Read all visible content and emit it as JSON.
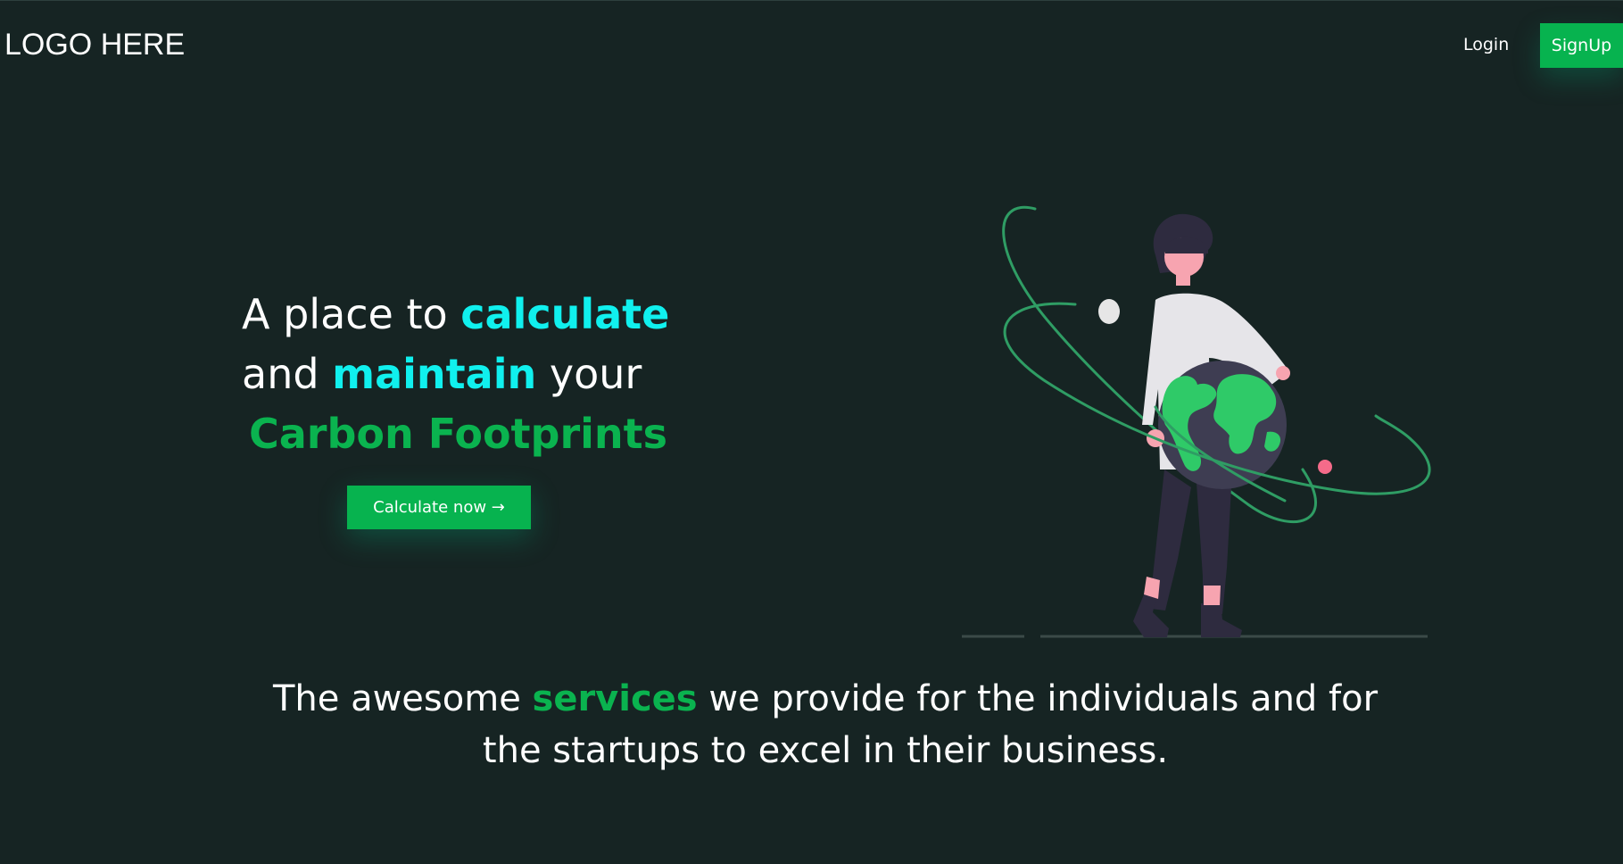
{
  "header": {
    "logo_text": "LOGO HERE",
    "login_label": "Login",
    "signup_label": "SignUp"
  },
  "hero": {
    "line1_prefix": "A place to ",
    "line1_highlight": "calculate",
    "line2_prefix": "and ",
    "line2_highlight": "maintain",
    "line2_suffix": " your",
    "line3_highlight": "Carbon Footprints",
    "cta_label": "Calculate now →"
  },
  "services": {
    "prefix": "The awesome ",
    "highlight": "services",
    "suffix": " we provide for the individuals and for the startups to excel in their business."
  },
  "colors": {
    "background": "#162423",
    "brand_green": "#07b34f",
    "accent_cyan": "#10f0ee"
  },
  "illustration": {
    "icon": "woman-holding-globe-illustration"
  }
}
